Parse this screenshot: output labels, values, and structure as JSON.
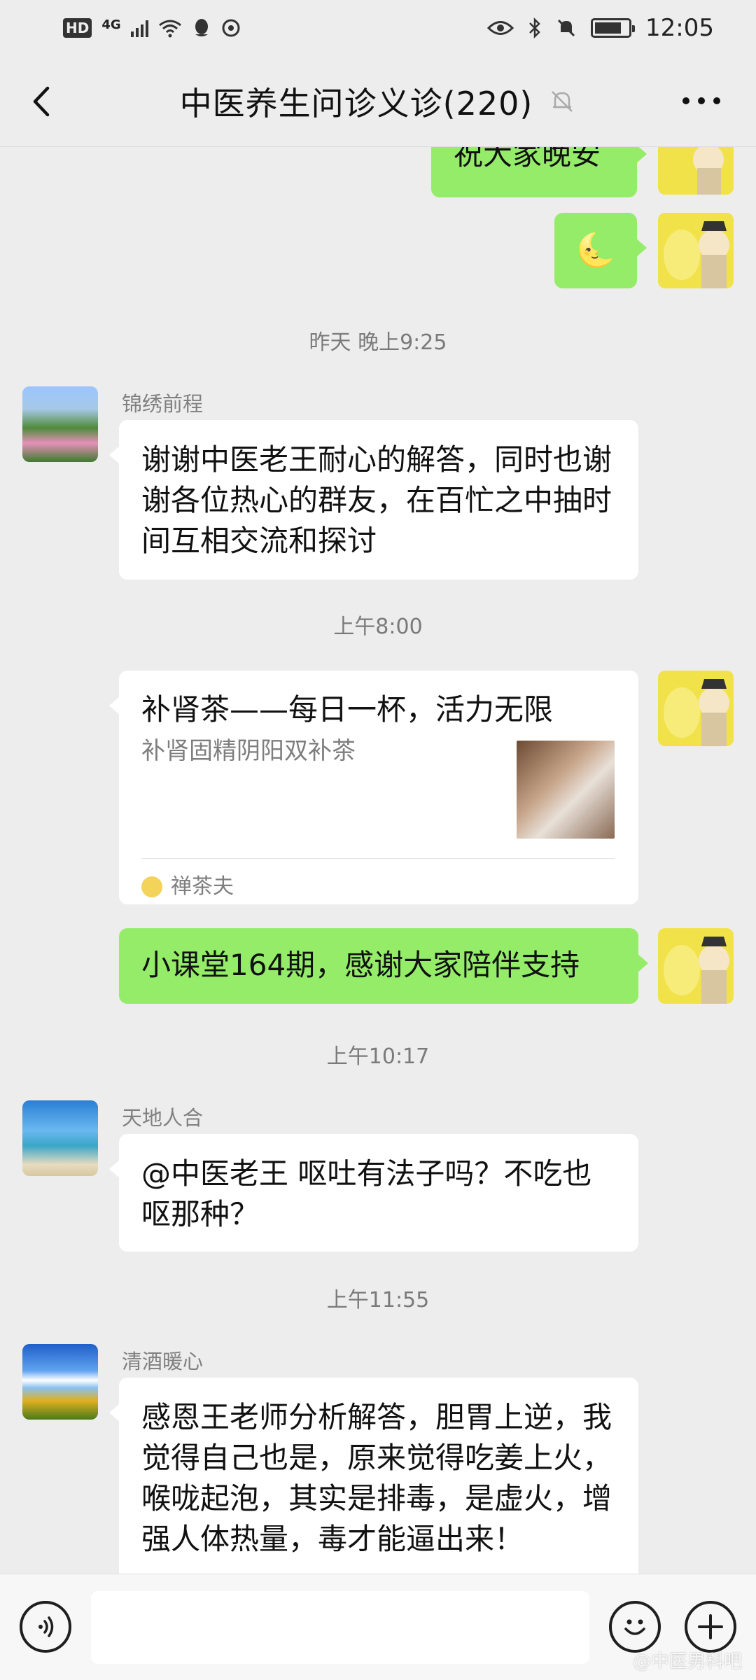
{
  "status_bar": {
    "hd": "HD",
    "network": "4G",
    "time": "12:05"
  },
  "header": {
    "title": "中医养生问诊义诊(220)"
  },
  "messages": {
    "m0_text": "祝大家晚安",
    "m1_emoji": "🌜",
    "t1": "昨天 晚上9:25",
    "m2_sender": "锦绣前程",
    "m2_text": "谢谢中医老王耐心的解答，同时也谢谢各位热心的群友，在百忙之中抽时间互相交流和探讨",
    "t2": "上午8:00",
    "card": {
      "title": "补肾茶——每日一杯，活力无限",
      "desc": "补肾固精阴阳双补茶",
      "source": "禅茶夫"
    },
    "m4_text": "小课堂164期，感谢大家陪伴支持",
    "t3": "上午10:17",
    "m5_sender": "天地人合",
    "m5_text": "@中医老王  呕吐有法子吗？不吃也呕那种？",
    "t4": "上午11:55",
    "m6_sender": "清酒暖心",
    "m6_text": "感恩王老师分析解答，胆胃上逆，我觉得自己也是，原来觉得吃姜上火，喉咙起泡，其实是排毒，是虚火，增强人体热量，毒才能逼出来！"
  },
  "input": {
    "placeholder": ""
  },
  "watermark": "@中医男科吧",
  "colors": {
    "background": "#ededed",
    "bubble_green": "#95ec69",
    "bubble_white": "#ffffff"
  },
  "icons": [
    "back-arrow-icon",
    "mute-bell-icon",
    "more-icon",
    "voice-icon",
    "emoji-icon",
    "plus-icon"
  ]
}
